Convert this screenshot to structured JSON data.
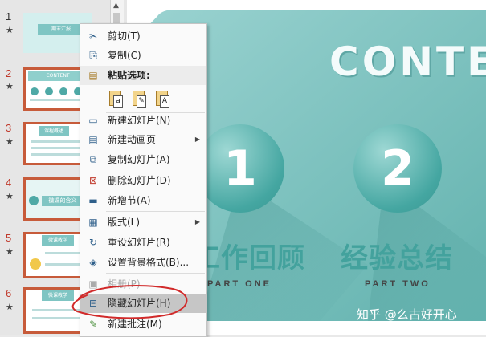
{
  "thumbnails": [
    {
      "number": "1",
      "star": "★",
      "caption": "期末汇报"
    },
    {
      "number": "2",
      "star": "★",
      "caption": "CONTENT"
    },
    {
      "number": "3",
      "star": "★",
      "caption": "课程概述"
    },
    {
      "number": "4",
      "star": "★",
      "caption": "微课的含义"
    },
    {
      "number": "5",
      "star": "★",
      "caption": "微课教学"
    },
    {
      "number": "6",
      "star": "★",
      "caption": "微课教学"
    }
  ],
  "slide": {
    "title": "CONTENT",
    "sections": [
      {
        "number": "1",
        "title": "工作回顾",
        "subtitle": "PART ONE"
      },
      {
        "number": "2",
        "title": "经验总结",
        "subtitle": "PART TWO"
      }
    ],
    "watermark": "知乎 @么古好开心"
  },
  "context_menu": {
    "items": [
      {
        "icon": "scissors-icon",
        "glyph": "✂",
        "label": "剪切(T)"
      },
      {
        "icon": "copy-icon",
        "glyph": "⎘",
        "label": "复制(C)"
      },
      {
        "icon": "paste-icon",
        "glyph": "📋",
        "label": "粘贴选项:"
      },
      {
        "icon": "new-slide-icon",
        "glyph": "▭",
        "label": "新建幻灯片(N)"
      },
      {
        "icon": "new-animation-page-icon",
        "glyph": "▤",
        "label": "新建动画页"
      },
      {
        "icon": "duplicate-slide-icon",
        "glyph": "⧉",
        "label": "复制幻灯片(A)"
      },
      {
        "icon": "delete-slide-icon",
        "glyph": "⊠",
        "label": "删除幻灯片(D)"
      },
      {
        "icon": "new-section-icon",
        "glyph": "▬",
        "label": "新增节(A)"
      },
      {
        "icon": "layout-icon",
        "glyph": "▦",
        "label": "版式(L)"
      },
      {
        "icon": "reset-slide-icon",
        "glyph": "↻",
        "label": "重设幻灯片(R)"
      },
      {
        "icon": "format-background-icon",
        "glyph": "◈",
        "label": "设置背景格式(B)..."
      },
      {
        "icon": "photo-album-icon",
        "glyph": "▣",
        "label": "相册(P)"
      },
      {
        "icon": "hide-slide-icon",
        "glyph": "⊟",
        "label": "隐藏幻灯片(H)"
      },
      {
        "icon": "new-comment-icon",
        "glyph": "✎",
        "label": "新建批注(M)"
      }
    ],
    "paste_options": [
      "a",
      "✎",
      "A"
    ]
  },
  "colors": {
    "accent": "#4ea9a6",
    "selection": "#c75b3a",
    "annotation": "#d12a2a"
  }
}
